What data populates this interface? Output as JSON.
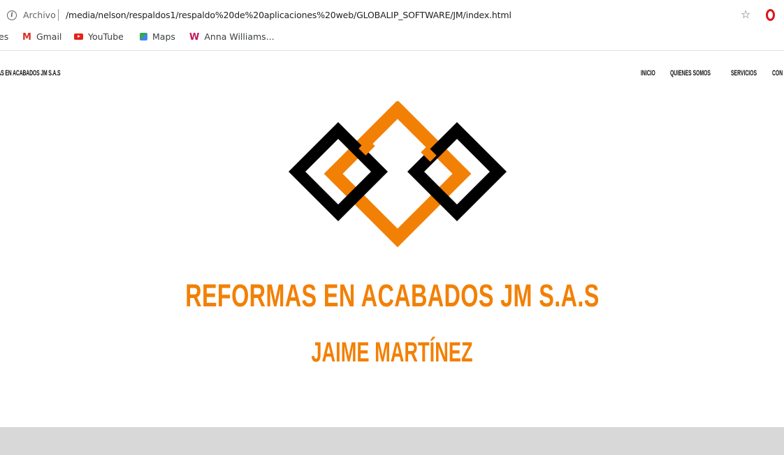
{
  "browser": {
    "info_icon": "info-icon",
    "address_label": "Archivo",
    "url": "/media/nelson/respaldos1/respaldo%20de%20aplicaciones%20web/GLOBALIP_SOFTWARE/JM/index.html",
    "star_icon": "star-icon",
    "opera_icon": "opera-icon",
    "bookmarks": [
      {
        "label": "es",
        "icon": ""
      },
      {
        "label": "Gmail",
        "icon": "gmail-icon"
      },
      {
        "label": "YouTube",
        "icon": "youtube-icon"
      },
      {
        "label": "Maps",
        "icon": "maps-icon"
      },
      {
        "label": "Anna Williams...",
        "icon": "w-icon"
      }
    ]
  },
  "site": {
    "brand": "RMAS EN ACABADOS JM S.A.S",
    "nav": [
      "INICIO",
      "QUIENES SOMOS",
      "SERVICIOS",
      "CON"
    ],
    "title": "REFORMAS EN ACABADOS JM S.A.S",
    "subtitle": "JAIME MARTÍNEZ"
  },
  "colors": {
    "accent_orange": "#f28005",
    "logo_black": "#000000",
    "footer_gray": "#d9d8d9"
  }
}
